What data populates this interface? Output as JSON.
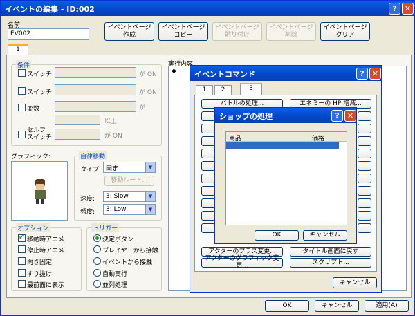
{
  "main": {
    "title": "イベントの編集 - ID:002",
    "name_label": "名前:",
    "name_value": "EV002",
    "page_buttons": [
      "イベントページ\n作成",
      "イベントページ\nコピー",
      "イベントページ\n貼り付け",
      "イベントページ\n削除",
      "イベントページ\nクリア"
    ],
    "page_tab": "1",
    "conditions_title": "条件",
    "cond_switch1": "スイッチ",
    "cond_switch2": "スイッチ",
    "cond_var": "変数",
    "cond_self_switch": "セルフ\nスイッチ",
    "ga_on": "が ON",
    "ga": "が",
    "ijou": "以上",
    "graphic_label": "グラフィック:",
    "autonomous_title": "自律移動",
    "type_label": "タイプ:",
    "type_value": "固定",
    "move_route": "移動ルート...",
    "speed_label": "速度:",
    "speed_value": "3: Slow",
    "freq_label": "頻度:",
    "freq_value": "3: Low",
    "options_title": "オプション",
    "options": [
      "移動時アニメ",
      "停止時アニメ",
      "向き固定",
      "すり抜け",
      "最前面に表示"
    ],
    "trigger_title": "トリガー",
    "triggers": [
      "決定ボタン",
      "プレイヤーから接触",
      "イベントから接触",
      "自動実行",
      "並列処理"
    ],
    "exec_label": "実行内容:",
    "exec_bullet": "◆",
    "ok": "OK",
    "cancel": "キャンセル",
    "apply": "適用(A)"
  },
  "cmd": {
    "title": "イベントコマンド",
    "tabs": [
      "1",
      "2",
      "3"
    ],
    "buttons_left": [
      "バトルの処理...",
      "アクターのプラス変更...",
      "アクターのグラフィック変更..."
    ],
    "buttons_right": [
      "エネミーの HP 増減...",
      "タイトル画面に戻す",
      "スクリプト..."
    ],
    "cancel": "キャンセル"
  },
  "shop": {
    "title": "ショップの処理",
    "col_item": "商品",
    "col_price": "価格",
    "ok": "OK",
    "cancel": "キャンセル"
  }
}
